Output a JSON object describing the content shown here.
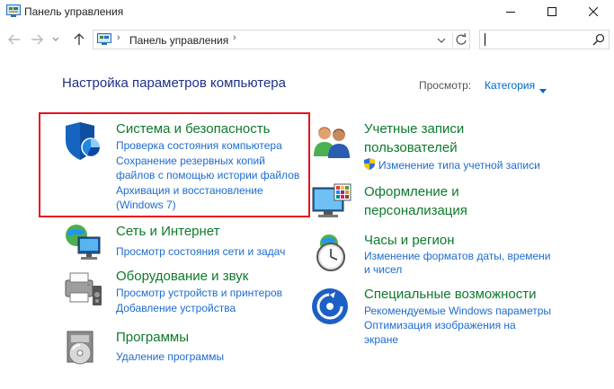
{
  "window": {
    "title": "Панель управления",
    "controls": {
      "minimize": "minimize-icon",
      "maximize": "maximize-icon",
      "close": "close-icon"
    }
  },
  "address_bar": {
    "path_root_icon": "control-panel-icon",
    "separator": "›",
    "path": "Панель управления",
    "search_placeholder": ""
  },
  "header": {
    "title": "Настройка параметров компьютера",
    "view_label": "Просмотр:",
    "view_value": "Категория"
  },
  "categories": {
    "system": {
      "title": "Система и безопасность",
      "links": [
        "Проверка состояния компьютера",
        "Сохранение резервных копий",
        "файлов с помощью истории файлов",
        "Архивация и восстановление",
        "(Windows 7)"
      ]
    },
    "network": {
      "title": "Сеть и Интернет",
      "links": [
        "Просмотр состояния сети и задач"
      ]
    },
    "hardware": {
      "title": "Оборудование и звук",
      "links": [
        "Просмотр устройств и принтеров",
        "Добавление устройства"
      ]
    },
    "programs": {
      "title": "Программы",
      "links": [
        "Удаление программы"
      ]
    },
    "accounts": {
      "title_line1": "Учетные записи",
      "title_line2": "пользователей",
      "links": [
        "Изменение типа учетной записи"
      ]
    },
    "appearance": {
      "title_line1": "Оформление и",
      "title_line2": "персонализация",
      "links": []
    },
    "clock": {
      "title": "Часы и регион",
      "links": [
        "Изменение форматов даты, времени",
        "и чисел"
      ]
    },
    "access": {
      "title": "Специальные возможности",
      "links": [
        "Рекомендуемые Windows параметры",
        "Оптимизация изображения на",
        "экране"
      ]
    }
  },
  "colors": {
    "category_title": "#0d7a2b",
    "link": "#1d6bd1",
    "heading": "#1e3287",
    "highlight_border": "#e8121c"
  }
}
